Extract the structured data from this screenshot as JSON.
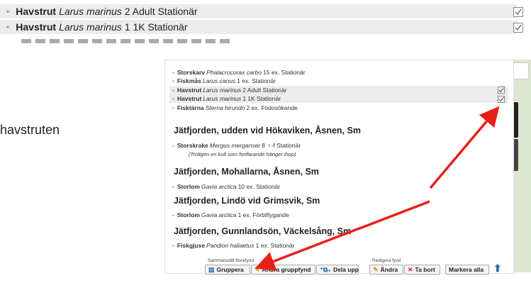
{
  "top_rows": [
    {
      "species": "Havstrut",
      "latin": "Larus marinus",
      "detail": "2 Adult Stationär"
    },
    {
      "species": "Havstrut",
      "latin": "Larus marinus",
      "detail": "1 1K Stationär"
    }
  ],
  "side_label": "havstruten",
  "panel": {
    "rows_top": [
      {
        "species": "Storskarv",
        "latin": "Phalacrocorax carbo",
        "detail": "15 ex. Stationär"
      },
      {
        "species": "Fiskmås",
        "latin": "Larus canus",
        "detail": "1 ex. Stationär"
      },
      {
        "species": "Havstrut",
        "latin": "Larus marinus",
        "detail": "2 Adult Stationär"
      },
      {
        "species": "Havstrut",
        "latin": "Larus marinus",
        "detail": "1 1K Stationär"
      },
      {
        "species": "Fisktärna",
        "latin": "Sterna hirundo",
        "detail": "2 ex. Födosökande"
      }
    ],
    "locations": [
      {
        "title": "Jätfjorden, udden vid Hökaviken, Åsnen, Sm",
        "species": "Storskrake",
        "latin": "Mergus merganser",
        "detail": "8 ♀-f Stationär",
        "note": "(Troligen en kull som fortfarande hänger ihop)"
      },
      {
        "title": "Jätfjorden, Mohallarna, Åsnen, Sm",
        "species": "Storlom",
        "latin": "Gavia arctica",
        "detail": "10 ex. Stationär"
      },
      {
        "title": "Jätfjorden, Lindö vid Grimsvik, Sm",
        "species": "Storlom",
        "latin": "Gavia arctica",
        "detail": "1 ex. Förbiflygande"
      },
      {
        "title": "Jätfjorden, Gunnlandsön, Väckelsång, Sm",
        "species": "Fiskgjuse",
        "latin": "Pandion haliaetus",
        "detail": "1 ex. Stationär"
      }
    ],
    "toolbar": {
      "group1_label": "Sammanställ flockfynd",
      "group2_label": "Redigera fynd",
      "gruppera": "Gruppera",
      "andra_gruppfynd": "Ändra gruppfynd",
      "dela_upp": "Dela upp",
      "andra": "Ändra",
      "ta_bort": "Ta bort",
      "markera_alla": "Markera alla"
    }
  },
  "colors": {
    "arrow": "#e8201a",
    "highlight": "#ececec",
    "accent": "#2a6db5"
  }
}
